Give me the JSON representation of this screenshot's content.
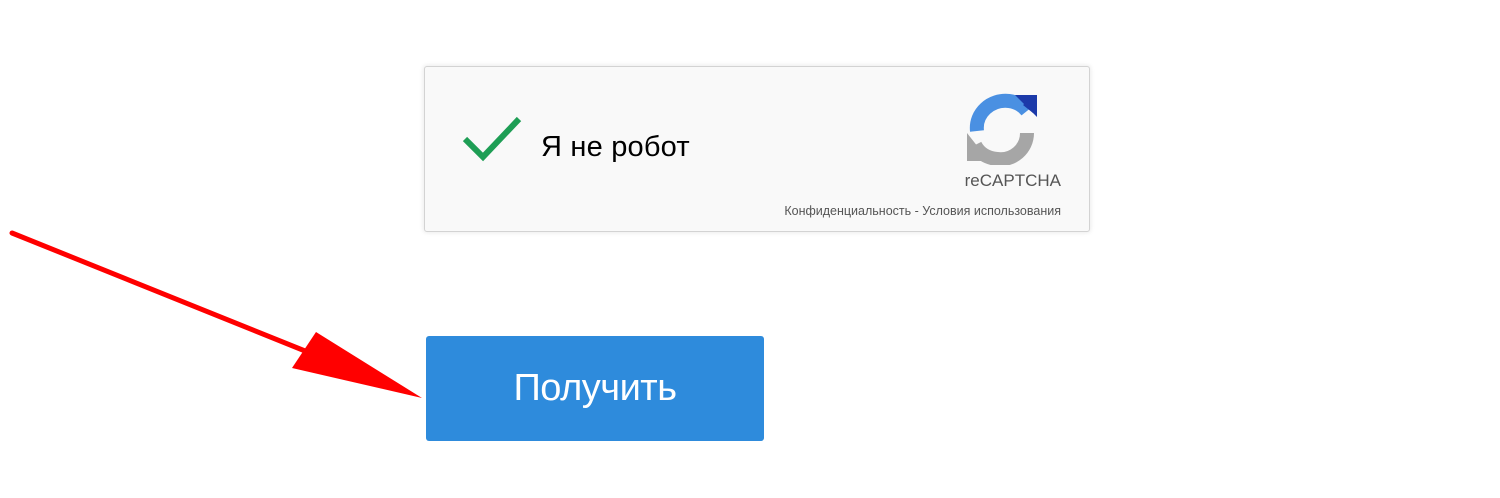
{
  "recaptcha": {
    "label": "Я не робот",
    "brand": "reCAPTCHA",
    "privacy_link": "Конфиденциальность",
    "separator": " - ",
    "terms_link": "Условия использования",
    "checked": true,
    "check_color": "#1e9e55",
    "logo_icon": "recaptcha-logo-icon"
  },
  "form": {
    "submit_label": "Получить",
    "submit_color": "#2e8bdc"
  },
  "annotation": {
    "arrow_icon": "red-arrow-icon",
    "arrow_color": "#ff0000"
  }
}
